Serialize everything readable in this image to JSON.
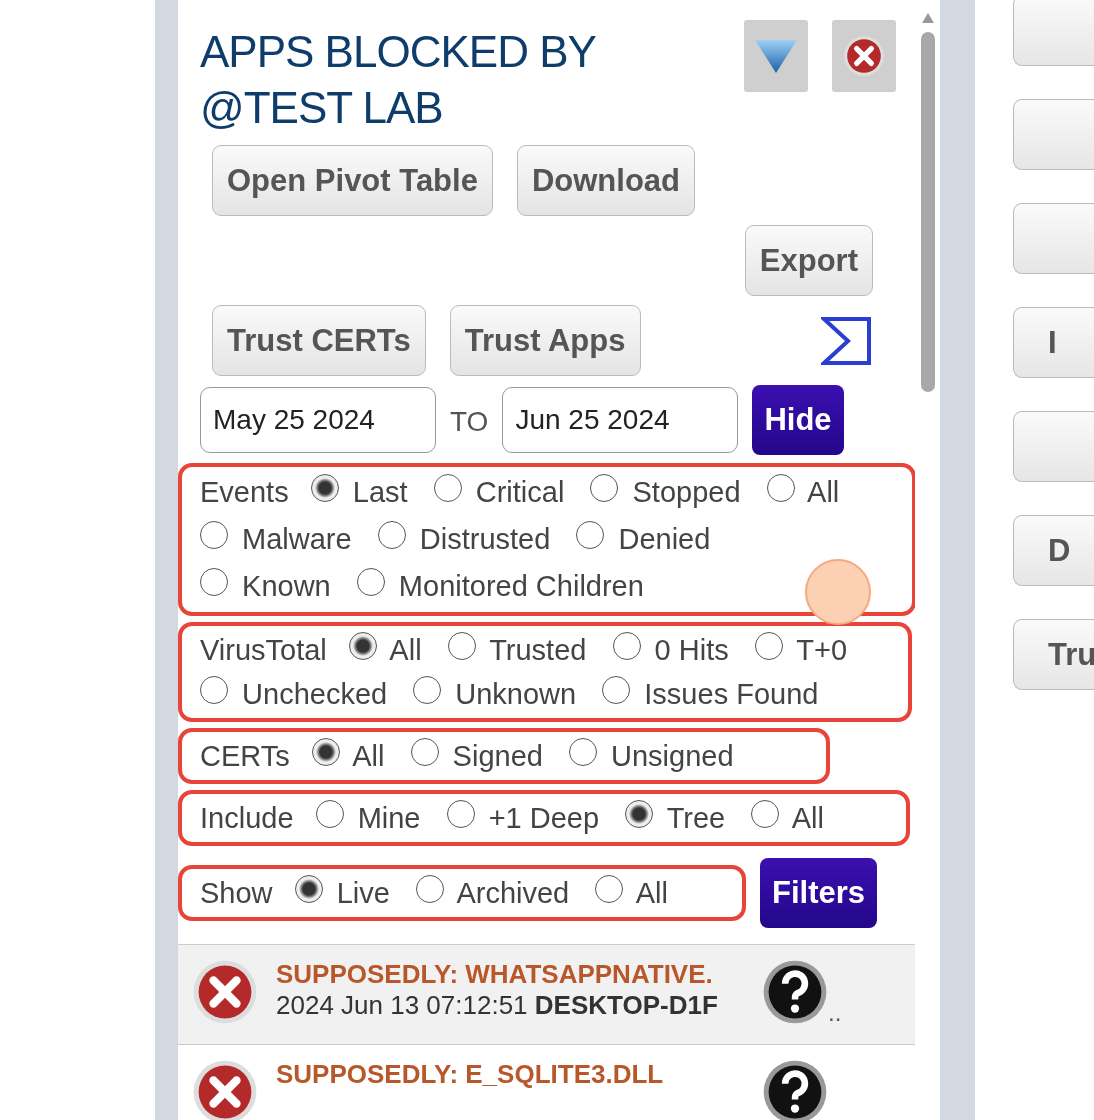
{
  "panel": {
    "title": "APPS BLOCKED BY @TEST LAB",
    "button_rows": [
      {
        "items": [
          {
            "kind": "button",
            "label": "Open Pivot Table"
          },
          {
            "kind": "button",
            "label": "Download"
          }
        ]
      },
      {
        "items": [
          {
            "kind": "button",
            "label": "Export"
          }
        ]
      },
      {
        "items": [
          {
            "kind": "button",
            "label": "Trust CERTs"
          },
          {
            "kind": "button",
            "label": "Trust Apps"
          },
          {
            "kind": "sigma"
          }
        ]
      }
    ],
    "date_range": {
      "from": "May 25 2024",
      "separator": "TO",
      "to": "Jun 25 2024",
      "button": "Hide"
    },
    "filter_groups": [
      {
        "label": "Events",
        "options": [
          {
            "label": "Last",
            "selected": true
          },
          {
            "label": "Critical",
            "selected": false
          },
          {
            "label": "Stopped",
            "selected": false
          },
          {
            "label": "All",
            "selected": false
          },
          {
            "label": "Malware",
            "selected": false
          },
          {
            "label": "Distrusted",
            "selected": false
          },
          {
            "label": "Denied",
            "selected": false
          },
          {
            "label": "Known",
            "selected": false
          },
          {
            "label": "Monitored Children",
            "selected": false
          }
        ]
      },
      {
        "label": "VirusTotal",
        "options": [
          {
            "label": "All",
            "selected": true
          },
          {
            "label": "Trusted",
            "selected": false
          },
          {
            "label": "0 Hits",
            "selected": false
          },
          {
            "label": "T+0",
            "selected": false
          },
          {
            "label": "Unchecked",
            "selected": false
          },
          {
            "label": "Unknown",
            "selected": false
          },
          {
            "label": "Issues Found",
            "selected": false
          }
        ]
      },
      {
        "label": "CERTs",
        "options": [
          {
            "label": "All",
            "selected": true
          },
          {
            "label": "Signed",
            "selected": false
          },
          {
            "label": "Unsigned",
            "selected": false
          }
        ]
      },
      {
        "label": "Include",
        "options": [
          {
            "label": "Mine",
            "selected": false
          },
          {
            "label": "+1 Deep",
            "selected": false
          },
          {
            "label": "Tree",
            "selected": true
          },
          {
            "label": "All",
            "selected": false
          }
        ]
      },
      {
        "label": "Show",
        "options": [
          {
            "label": "Live",
            "selected": true
          },
          {
            "label": "Archived",
            "selected": false
          },
          {
            "label": "All",
            "selected": false
          }
        ]
      }
    ],
    "filters_button": "Filters",
    "results": [
      {
        "title": "SUPPOSEDLY: WHATSAPPNATIVE.",
        "time": "2024 Jun 13 07:12:51",
        "host": "DESKTOP-D1F",
        "more": ".."
      },
      {
        "title": "SUPPOSEDLY: E_SQLITE3.DLL"
      }
    ]
  },
  "side_buttons": [
    {
      "kind": "blank"
    },
    {
      "kind": "blank"
    },
    {
      "kind": "blank"
    },
    {
      "kind": "text",
      "label": "I"
    },
    {
      "kind": "blank"
    },
    {
      "kind": "text",
      "label": "D"
    },
    {
      "kind": "text",
      "label": "Tru"
    }
  ]
}
